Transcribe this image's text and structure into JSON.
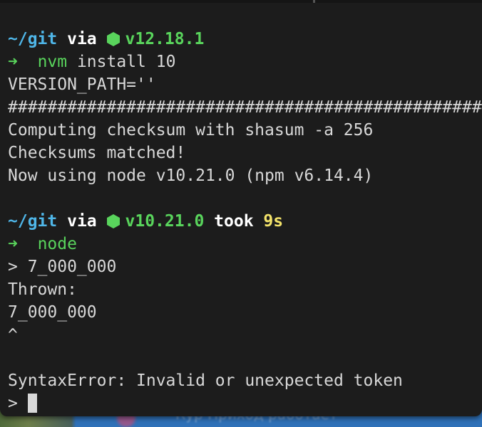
{
  "prompt1": {
    "dir": "~/git",
    "via": "via",
    "node_icon": "nodejs-hexagon-icon",
    "node_version": "v12.18.1"
  },
  "cmd1": {
    "arrow": "➜",
    "command": "nvm",
    "args": " install 10"
  },
  "output1": [
    "VERSION_PATH=''",
    "######################################################################",
    "Computing checksum with shasum -a 256",
    "Checksums matched!",
    "Now using node v10.21.0 (npm v6.14.4)"
  ],
  "prompt2": {
    "dir": "~/git",
    "via": "via",
    "node_icon": "nodejs-hexagon-icon",
    "node_version": "v10.21.0",
    "took": "took",
    "duration": "9s"
  },
  "cmd2": {
    "arrow": "➜",
    "command": "node"
  },
  "repl": [
    "> 7_000_000",
    "Thrown:",
    "7_000_000",
    "^",
    "",
    "SyntaxError: Invalid or unexpected token"
  ],
  "repl_prompt": "> ",
  "behind": {
    "text": "Кур Приход работает"
  },
  "colors": {
    "background": "#1c1c1c",
    "foreground": "#d8d8d8",
    "directory": "#4fb6e8",
    "node_version": "#59d45c",
    "duration": "#f3e36a"
  }
}
